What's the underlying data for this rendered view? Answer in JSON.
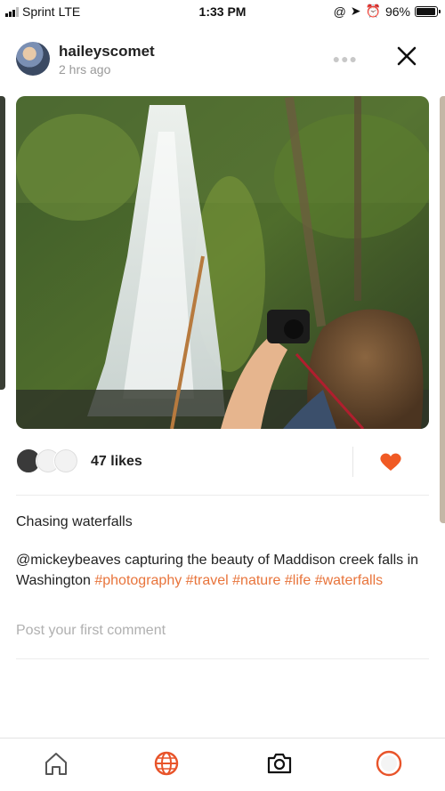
{
  "status_bar": {
    "carrier": "Sprint",
    "network": "LTE",
    "time": "1:33 PM",
    "battery": "96%",
    "battery_level": 0.96
  },
  "post": {
    "username": "haileyscomet",
    "timestamp": "2 hrs ago",
    "likes": "47 likes",
    "liked": true,
    "title": "Chasing waterfalls",
    "body_prefix": "@mickeybeaves capturing the beauty of Maddison creek falls in Washington",
    "hashtags": [
      "#photography",
      "#travel",
      "#nature",
      "#life",
      "#waterfalls"
    ],
    "comment_placeholder": "Post your first comment"
  },
  "icons": {
    "more": "more-icon",
    "close": "close-icon",
    "heart": "heart-icon",
    "home": "home-icon",
    "explore": "globe-icon",
    "camera": "camera-icon",
    "profile": "profile-ring-icon"
  },
  "colors": {
    "accent": "#e8743b",
    "heart": "#f05a24",
    "text": "#222222",
    "muted": "#999999"
  }
}
